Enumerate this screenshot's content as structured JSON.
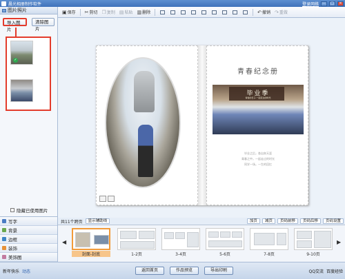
{
  "window": {
    "title": "晨光相册制作软件",
    "login_link": "登录网络",
    "controls": [
      "—",
      "□",
      "✕"
    ]
  },
  "left_panel": {
    "header": "图片照片",
    "import_btn": "导入图片",
    "clear_btn": "清除图片",
    "hide_used_label": "隐藏已使用图片",
    "tabs": [
      "写字",
      "背景",
      "边框",
      "装饰",
      "美饰图"
    ]
  },
  "toolbar": {
    "save": "保存",
    "cut": "剪切",
    "copy": "复制",
    "paste": "粘贴",
    "delete": "删除",
    "undo": "撤销",
    "redo": "重做"
  },
  "spread": {
    "right_title": "青春纪念册",
    "photo_caption": "毕业季",
    "photo_subcaption": "青春的日子·一起走过的时光",
    "poem_lines": [
      "毕业之后，各自奔天涯",
      "青春之中，一起走过的时光",
      "同学一场，一生的回忆"
    ]
  },
  "strip_bar": {
    "page_info": "共11个跨页",
    "show_guides": "显示辅助线",
    "add": "加页",
    "remove": "减页",
    "front": "页码前移",
    "back": "页码后移",
    "settings": "页码设置"
  },
  "pages": [
    "封面-封底",
    "1-2页",
    "3-4页",
    "5-6页",
    "7-8页",
    "9-10页"
  ],
  "bottom_bar": {
    "left_text": "新年快乐",
    "link_text": "动态",
    "btn_back": "返回首页",
    "btn_preview": "作品预览",
    "btn_export": "导出印刷",
    "right1": "QQ交流",
    "right2": "百度经验"
  },
  "accent_colors": {
    "highlight": "#e33b2b",
    "active_page": "#f29a38",
    "titlebar": "#3f72bb"
  }
}
